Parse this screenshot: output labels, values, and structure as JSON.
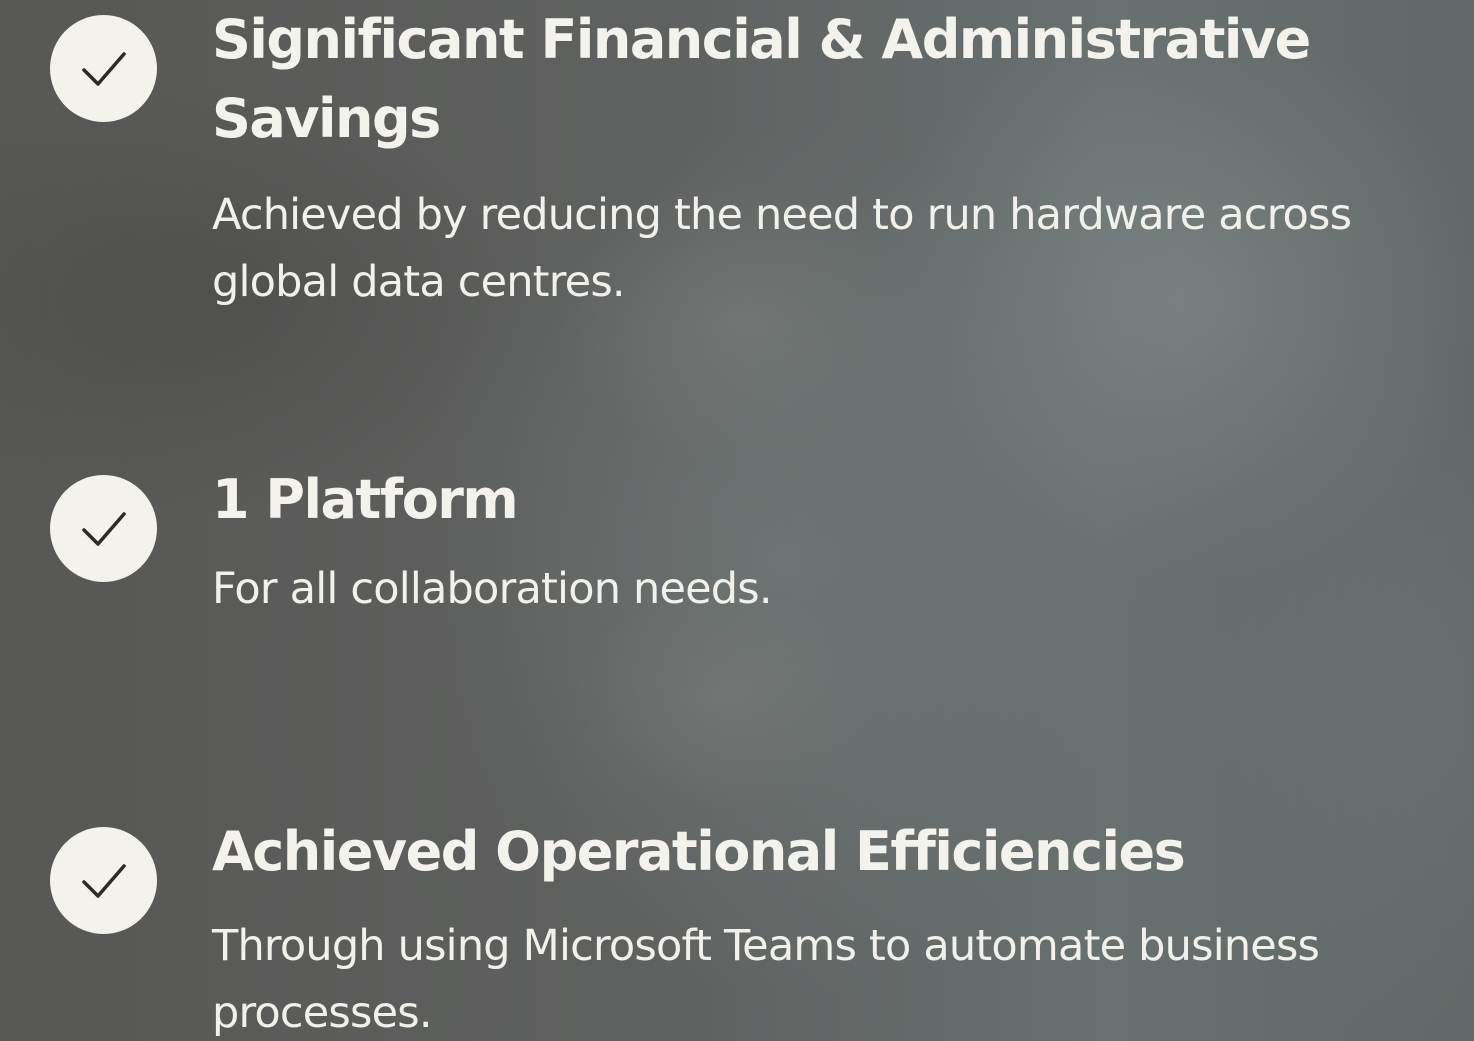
{
  "benefits": [
    {
      "icon": "check-icon",
      "title": "Significant Financial & Administrative Savings",
      "description": "Achieved by reducing the need to run hardware across global data centres."
    },
    {
      "icon": "check-icon",
      "title": "1 Platform",
      "description": "For all collaboration needs."
    },
    {
      "icon": "check-icon",
      "title": "Achieved Operational Efficiencies",
      "description": "Through using Microsoft Teams to automate business processes."
    }
  ],
  "colors": {
    "check_circle": "#f4f2ec",
    "check_mark": "#2b2b2b",
    "text": "#f4f2ec",
    "background": "#5a5a58"
  }
}
